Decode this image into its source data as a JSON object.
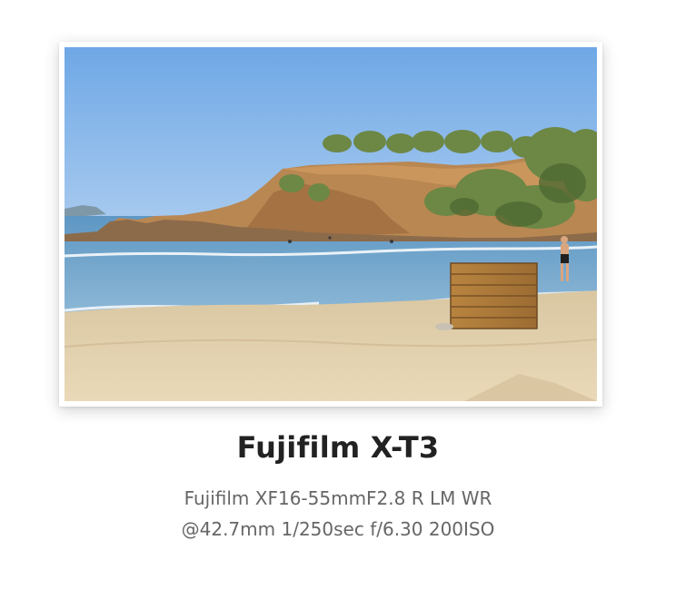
{
  "photo": {
    "icon": "beach-photo",
    "alt_colors": {
      "sky": "#7fb4e8",
      "sea": "#6a9ec4",
      "sand": "#e3d3b2",
      "cliff": "#c48a52",
      "trees": "#6b8340",
      "crate": "#b07c3e"
    }
  },
  "caption": {
    "camera_model": "Fujifilm X-T3",
    "lens": "Fujifilm XF16-55mmF2.8 R LM WR",
    "settings": "@42.7mm 1/250sec f/6.30 200ISO"
  }
}
